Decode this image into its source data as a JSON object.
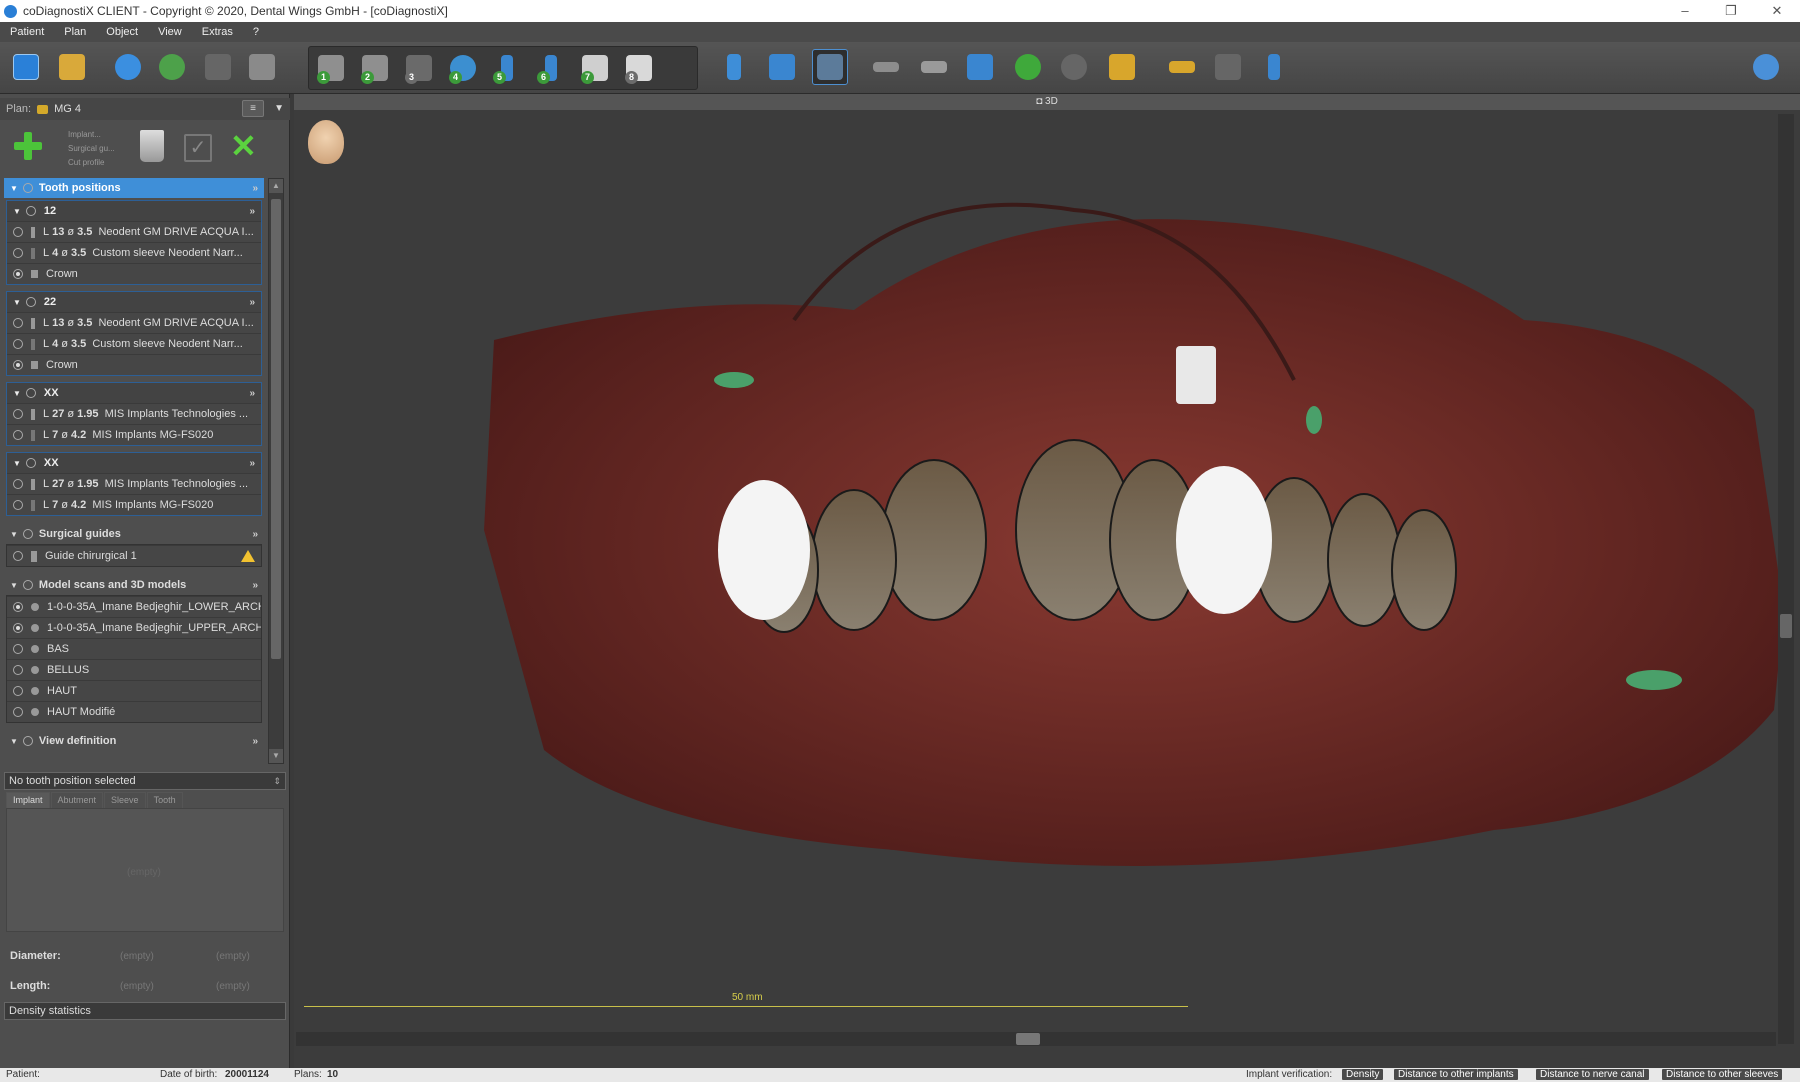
{
  "title": "coDiagnostiX CLIENT - Copyright © 2020, Dental Wings GmbH - [coDiagnostiX]",
  "window": {
    "minimize": "–",
    "restore": "❐",
    "close": "✕"
  },
  "menu": [
    "Patient",
    "Plan",
    "Object",
    "View",
    "Extras",
    "?"
  ],
  "toolbar": {
    "numbered_steps": [
      "1",
      "2",
      "3",
      "4",
      "5",
      "6",
      "7",
      "8"
    ],
    "accent_blue": "#2a80d8",
    "accent_green": "#4cc43a"
  },
  "plan": {
    "label": "Plan:",
    "name": "MG 4"
  },
  "actions": {
    "add_options": [
      "Implant...",
      "Surgical gu...",
      "Cut profile"
    ]
  },
  "tooth_positions": {
    "header": "Tooth positions",
    "groups": [
      {
        "name": "12",
        "rows": [
          {
            "kind": "implant",
            "L": "13",
            "d": "3.5",
            "desc": "Neodent GM DRIVE ACQUA I..."
          },
          {
            "kind": "sleeve",
            "L": "4",
            "d": "3.5",
            "desc": "Custom sleeve Neodent Narr..."
          },
          {
            "kind": "crown",
            "desc": "Crown"
          }
        ]
      },
      {
        "name": "22",
        "rows": [
          {
            "kind": "implant",
            "L": "13",
            "d": "3.5",
            "desc": "Neodent GM DRIVE ACQUA I..."
          },
          {
            "kind": "sleeve",
            "L": "4",
            "d": "3.5",
            "desc": "Custom sleeve Neodent Narr..."
          },
          {
            "kind": "crown",
            "desc": "Crown"
          }
        ]
      },
      {
        "name": "XX",
        "rows": [
          {
            "kind": "implant",
            "L": "27",
            "d": "1.95",
            "desc": "MIS Implants Technologies ..."
          },
          {
            "kind": "sleeve",
            "L": "7",
            "d": "4.2",
            "desc": "MIS Implants MG-FS020"
          }
        ]
      },
      {
        "name": "XX",
        "rows": [
          {
            "kind": "implant",
            "L": "27",
            "d": "1.95",
            "desc": "MIS Implants Technologies ..."
          },
          {
            "kind": "sleeve",
            "L": "7",
            "d": "4.2",
            "desc": "MIS Implants MG-FS020"
          }
        ]
      }
    ]
  },
  "surgical_guides": {
    "header": "Surgical guides",
    "items": [
      "Guide chirurgical 1"
    ]
  },
  "models": {
    "header": "Model scans and 3D models",
    "items": [
      "1-0-0-35A_Imane Bedjeghir_LOWER_ARCH",
      "1-0-0-35A_Imane Bedjeghir_UPPER_ARCH",
      "BAS",
      "BELLUS",
      "HAUT",
      "HAUT Modifié"
    ]
  },
  "view_definition": {
    "header": "View definition"
  },
  "selection": "No tooth position selected",
  "tabs": [
    "Implant",
    "Abutment",
    "Sleeve",
    "Tooth"
  ],
  "props": {
    "empty": "(empty)",
    "diameter_label": "Diameter:",
    "length_label": "Length:"
  },
  "density": "Density statistics",
  "viewport": {
    "title": "3D",
    "scale_label": "50 mm"
  },
  "status": {
    "patient": "Patient:",
    "dob_label": "Date of birth:",
    "dob": "20001124",
    "plans_label": "Plans:",
    "plans": "10",
    "verification_label": "Implant verification:",
    "buttons": [
      "Density",
      "Distance to other implants",
      "Distance to nerve canal",
      "Distance to other sleeves"
    ]
  }
}
